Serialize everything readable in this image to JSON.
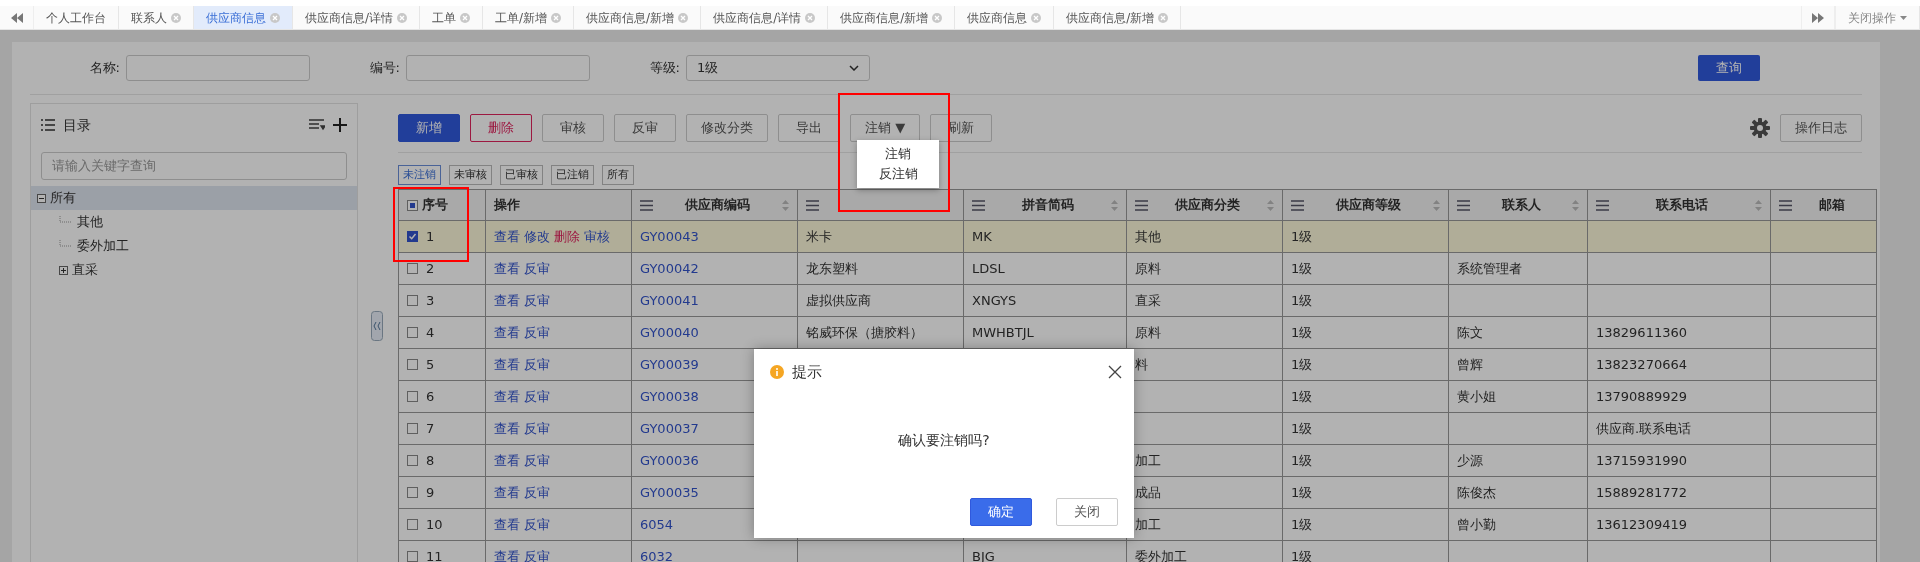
{
  "tab_bar": {
    "tabs": [
      {
        "label": "个人工作台",
        "selected": false,
        "closable": false
      },
      {
        "label": "联系人",
        "selected": false,
        "closable": true
      },
      {
        "label": "供应商信息",
        "selected": true,
        "closable": true
      },
      {
        "label": "供应商信息/详情",
        "selected": false,
        "closable": true
      },
      {
        "label": "工单",
        "selected": false,
        "closable": true
      },
      {
        "label": "工单/新增",
        "selected": false,
        "closable": true
      },
      {
        "label": "供应商信息/新增",
        "selected": false,
        "closable": true
      },
      {
        "label": "供应商信息/详情",
        "selected": false,
        "closable": true
      },
      {
        "label": "供应商信息/新增",
        "selected": false,
        "closable": true
      },
      {
        "label": "供应商信息",
        "selected": false,
        "closable": true
      },
      {
        "label": "供应商信息/新增",
        "selected": false,
        "closable": true
      }
    ],
    "close_menu": "关闭操作"
  },
  "filters": {
    "name_label": "名称:",
    "code_label": "编号:",
    "grade_label": "等级:",
    "grade_value": "1级",
    "query_button": "查询"
  },
  "catalog": {
    "title": "目录",
    "search_placeholder": "请输入关键字查询",
    "tree": [
      {
        "label": "所有",
        "expanded": true,
        "selected": true,
        "children": [
          {
            "label": "其他",
            "selected": false
          },
          {
            "label": "委外加工",
            "selected": false
          },
          {
            "label": "直采",
            "selected": false,
            "expanded": false
          }
        ]
      }
    ]
  },
  "toolbar": {
    "buttons": [
      {
        "label": "新增",
        "kind": "primary"
      },
      {
        "label": "删除",
        "kind": "danger"
      },
      {
        "label": "审核",
        "kind": "default"
      },
      {
        "label": "反审",
        "kind": "default"
      },
      {
        "label": "修改分类",
        "kind": "default"
      },
      {
        "label": "导出",
        "kind": "default"
      },
      {
        "label": "注销 ▼",
        "kind": "dropdown",
        "expanded": true,
        "menu": [
          "注销",
          "反注销"
        ]
      },
      {
        "label": "刷新",
        "kind": "default"
      }
    ],
    "log_button": "操作日志"
  },
  "status_filters": [
    {
      "label": "未注销",
      "selected": true
    },
    {
      "label": "未审核",
      "selected": false
    },
    {
      "label": "已审核",
      "selected": false
    },
    {
      "label": "已注销",
      "selected": false
    },
    {
      "label": "所有",
      "selected": false
    }
  ],
  "table": {
    "select_all_indeterminate": true,
    "columns": [
      {
        "label": "序号",
        "menu": false,
        "sortable": false
      },
      {
        "label": "操作",
        "menu": false,
        "sortable": false
      },
      {
        "label": "供应商编码",
        "menu": true,
        "sortable": true
      },
      {
        "menu": true,
        "sortable": false
      },
      {
        "label": "拼音简码",
        "menu": true,
        "sortable": true
      },
      {
        "label": "供应商分类",
        "menu": true,
        "sortable": true
      },
      {
        "label": "供应商等级",
        "menu": true,
        "sortable": true
      },
      {
        "label": "联系人",
        "menu": true,
        "sortable": true
      },
      {
        "label": "联系电话",
        "menu": true,
        "sortable": true
      },
      {
        "label": "邮箱",
        "menu": true,
        "sortable": false
      }
    ],
    "rows": [
      {
        "index": "1",
        "checked": true,
        "selected": true,
        "actions": [
          {
            "label": "查看",
            "kind": "link"
          },
          {
            "label": "修改",
            "kind": "link"
          },
          {
            "label": "删除",
            "kind": "danger"
          },
          {
            "label": "审核",
            "kind": "link"
          }
        ],
        "code": "GY00043",
        "name": "米卡",
        "pinyin": "MK",
        "category": "其他",
        "grade": "1级"
      },
      {
        "index": "2",
        "checked": false,
        "selected": false,
        "actions": [
          {
            "label": "查看",
            "kind": "link"
          },
          {
            "label": "反审",
            "kind": "link"
          }
        ],
        "code": "GY00042",
        "name": "龙东塑料",
        "pinyin": "LDSL",
        "category": "原料",
        "grade": "1级",
        "contact": "系统管理者"
      },
      {
        "index": "3",
        "checked": false,
        "selected": false,
        "actions": [
          {
            "label": "查看",
            "kind": "link"
          },
          {
            "label": "反审",
            "kind": "link"
          }
        ],
        "code": "GY00041",
        "name": "虚拟供应商",
        "pinyin": "XNGYS",
        "category": "直采",
        "grade": "1级"
      },
      {
        "index": "4",
        "checked": false,
        "selected": false,
        "actions": [
          {
            "label": "查看",
            "kind": "link"
          },
          {
            "label": "反审",
            "kind": "link"
          }
        ],
        "code": "GY00040",
        "name": "铭威环保（搪胶料）",
        "pinyin": "MWHBTJL",
        "category": "原料",
        "grade": "1级",
        "contact": "陈文",
        "phone": "13829611360"
      },
      {
        "index": "5",
        "checked": false,
        "selected": false,
        "actions": [
          {
            "label": "查看",
            "kind": "link"
          },
          {
            "label": "反审",
            "kind": "link"
          }
        ],
        "code": "GY00039",
        "category": "料",
        "grade": "1级",
        "contact": "曾辉",
        "phone": "13823270664"
      },
      {
        "index": "6",
        "checked": false,
        "selected": false,
        "actions": [
          {
            "label": "查看",
            "kind": "link"
          },
          {
            "label": "反审",
            "kind": "link"
          }
        ],
        "code": "GY00038",
        "grade": "1级",
        "contact": "黄小姐",
        "phone": "13790889929"
      },
      {
        "index": "7",
        "checked": false,
        "selected": false,
        "actions": [
          {
            "label": "查看",
            "kind": "link"
          },
          {
            "label": "反审",
            "kind": "link"
          }
        ],
        "code": "GY00037",
        "grade": "1级",
        "phone": "供应商.联系电话"
      },
      {
        "index": "8",
        "checked": false,
        "selected": false,
        "actions": [
          {
            "label": "查看",
            "kind": "link"
          },
          {
            "label": "反审",
            "kind": "link"
          }
        ],
        "code": "GY00036",
        "category": "加工",
        "grade": "1级",
        "contact": "少源",
        "phone": "13715931990"
      },
      {
        "index": "9",
        "checked": false,
        "selected": false,
        "actions": [
          {
            "label": "查看",
            "kind": "link"
          },
          {
            "label": "反审",
            "kind": "link"
          }
        ],
        "code": "GY00035",
        "category": "成品",
        "grade": "1级",
        "contact": "陈俊杰",
        "phone": "15889281772"
      },
      {
        "index": "10",
        "checked": false,
        "selected": false,
        "actions": [
          {
            "label": "查看",
            "kind": "link"
          },
          {
            "label": "反审",
            "kind": "link"
          }
        ],
        "code": "6054",
        "category": "加工",
        "grade": "1级",
        "contact": "曾小勤",
        "phone": "13612309419"
      },
      {
        "index": "11",
        "checked": false,
        "selected": false,
        "actions": [
          {
            "label": "查看",
            "kind": "link"
          },
          {
            "label": "反审",
            "kind": "link"
          }
        ],
        "code": "6032",
        "pinyin": "BJG",
        "category": "委外加工",
        "grade": "1级"
      }
    ]
  },
  "dialog": {
    "title": "提示",
    "message": "确认要注销吗?",
    "buttons": [
      {
        "label": "确定",
        "kind": "primary"
      },
      {
        "label": "关闭",
        "kind": "default"
      }
    ]
  }
}
